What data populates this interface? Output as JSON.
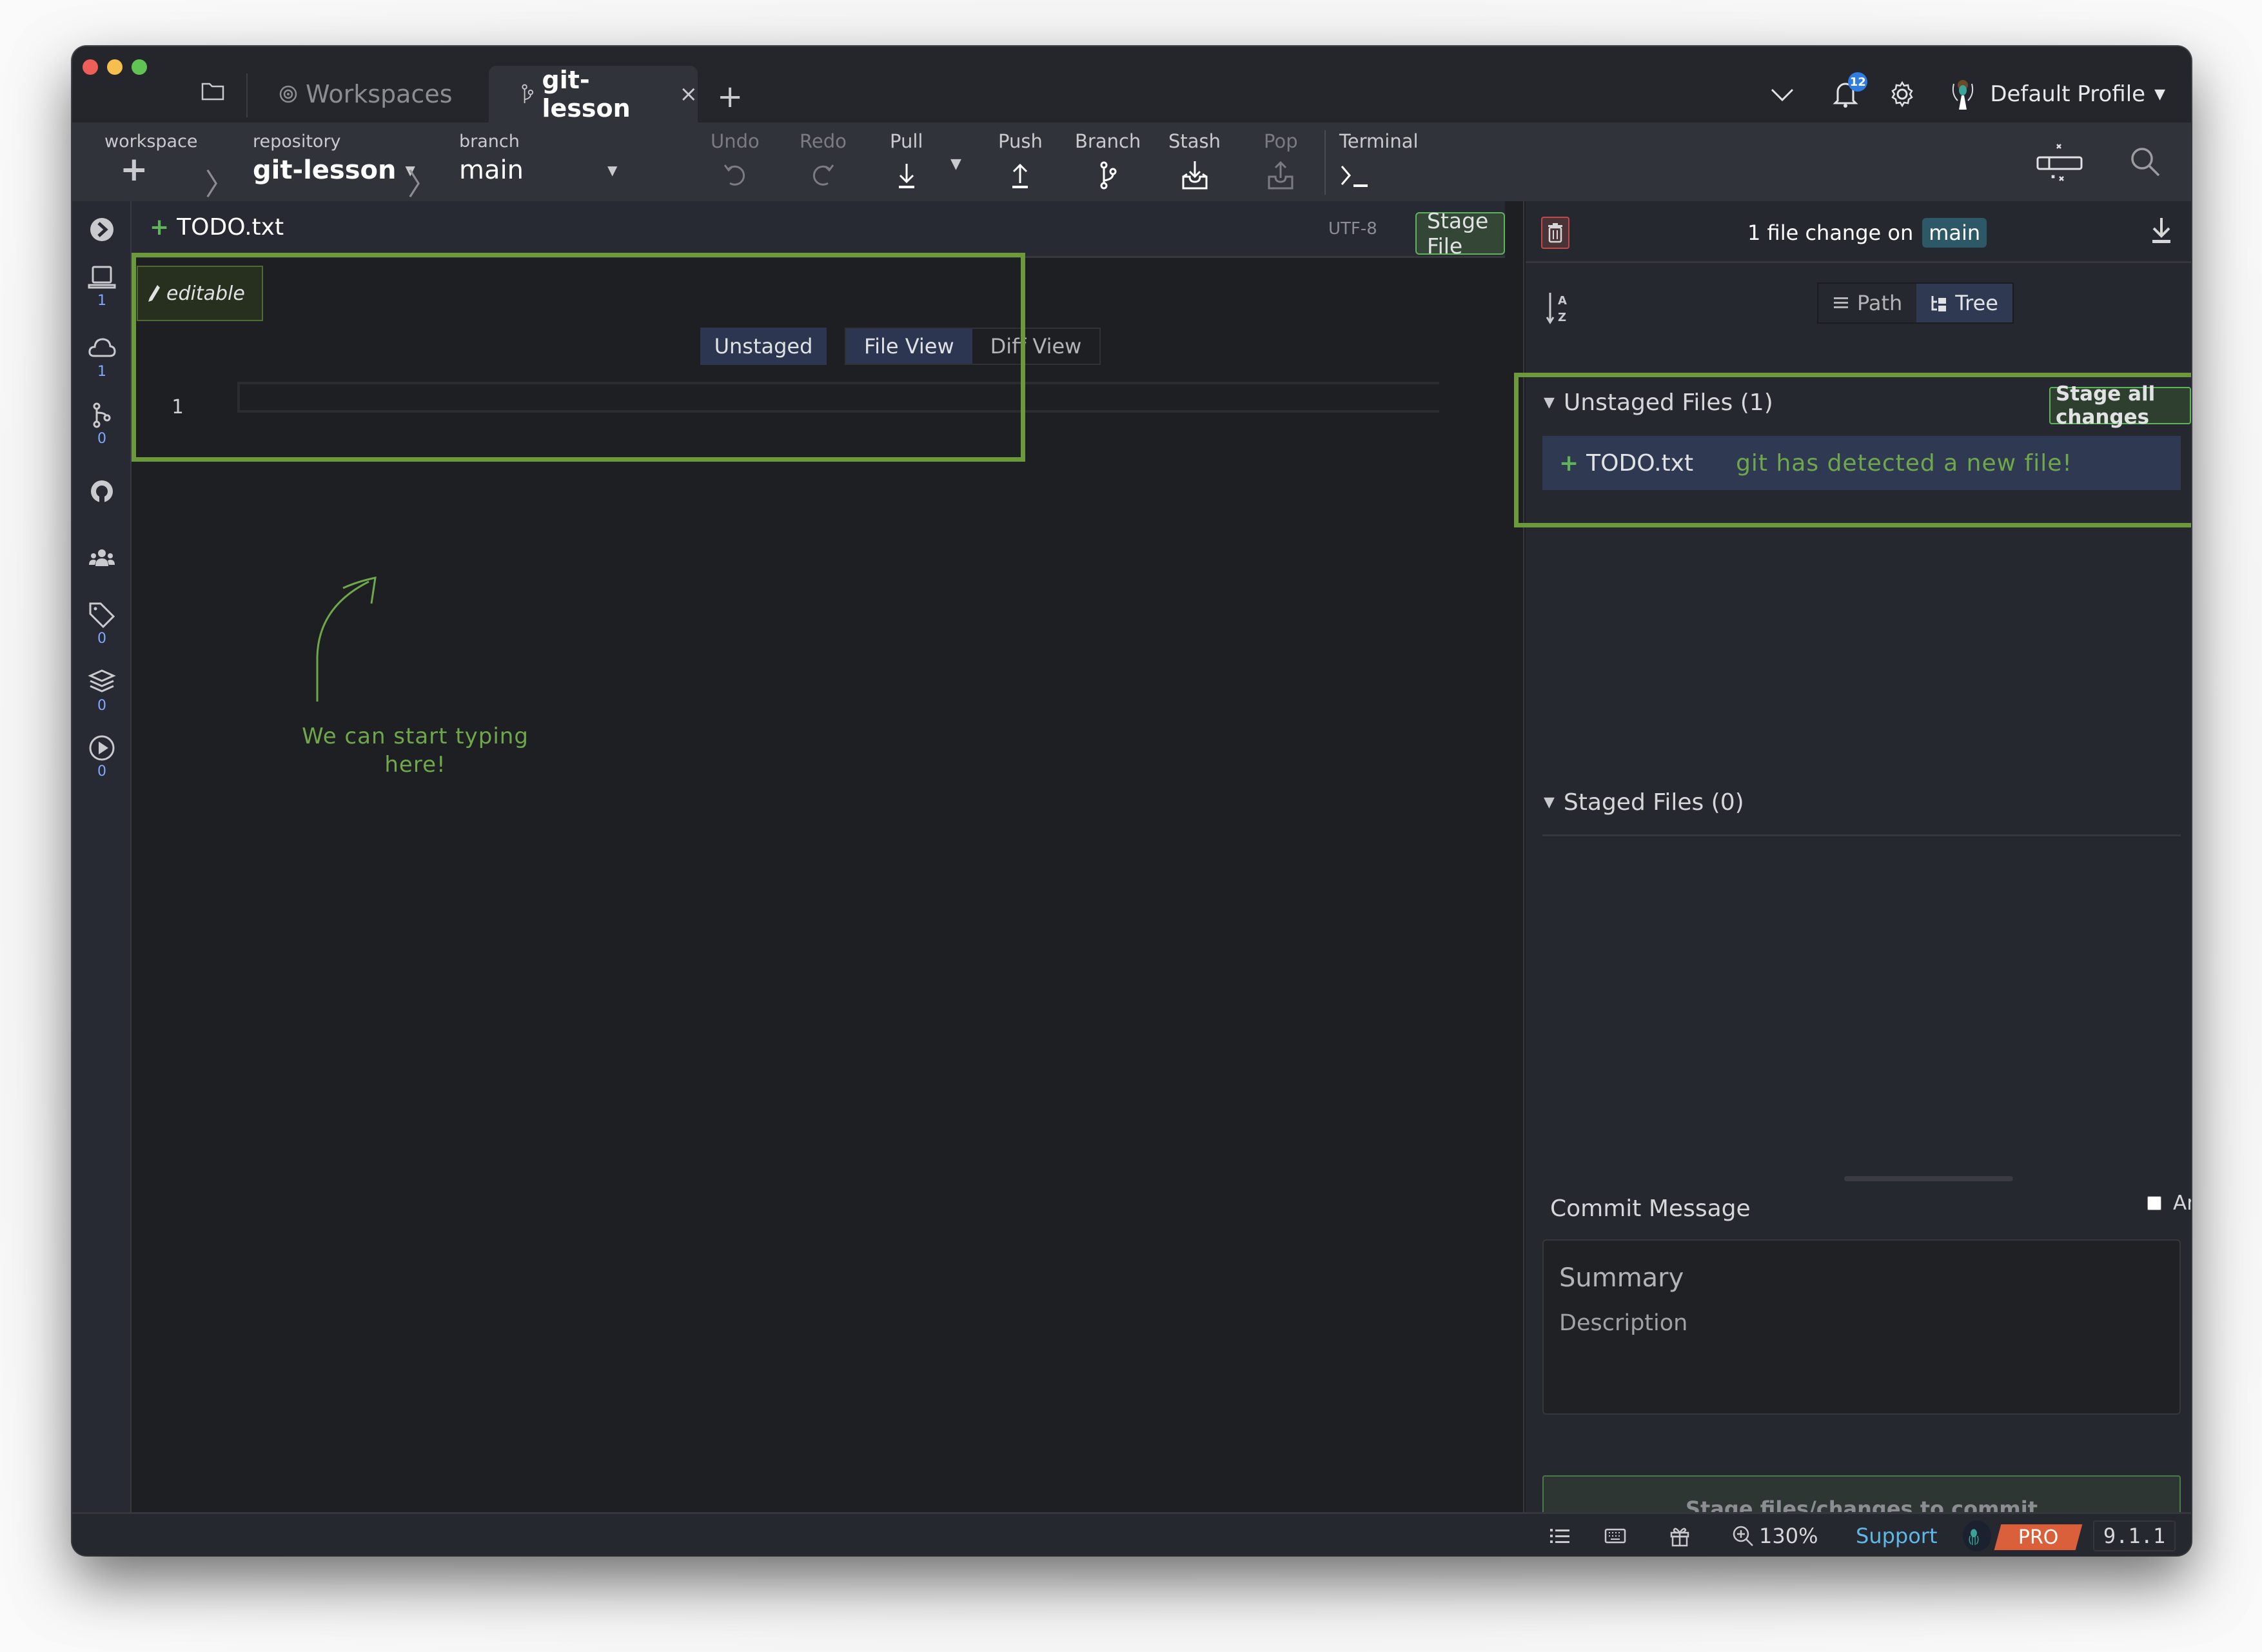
{
  "window": {
    "tabs": [
      {
        "label": "Workspaces",
        "icon": "workspaces-icon",
        "active": false
      },
      {
        "label": "git-lesson",
        "icon": "branch-icon",
        "active": true,
        "close": "×"
      }
    ],
    "new_tab": "+",
    "notifications_count": "12",
    "profile_name": "Default Profile"
  },
  "toolbar": {
    "workspace_label": "workspace",
    "workspace_value": "+",
    "repository_label": "repository",
    "repository_value": "git-lesson",
    "branch_label": "branch",
    "branch_value": "main",
    "actions": {
      "undo": "Undo",
      "redo": "Redo",
      "pull": "Pull",
      "push": "Push",
      "branch": "Branch",
      "stash": "Stash",
      "pop": "Pop",
      "terminal": "Terminal"
    }
  },
  "sidebar": {
    "items": [
      {
        "name": "expand",
        "icon": "expand-icon"
      },
      {
        "name": "local",
        "icon": "laptop-icon",
        "count": "1"
      },
      {
        "name": "remote",
        "icon": "cloud-icon",
        "count": "1"
      },
      {
        "name": "pull-requests",
        "icon": "pull-request-icon",
        "count": "0"
      },
      {
        "name": "github",
        "icon": "github-icon"
      },
      {
        "name": "teams",
        "icon": "team-icon"
      },
      {
        "name": "tags",
        "icon": "tag-icon",
        "count": "0"
      },
      {
        "name": "stashes",
        "icon": "layers-icon",
        "count": "0"
      },
      {
        "name": "actions",
        "icon": "play-icon",
        "count": "0"
      }
    ]
  },
  "editor": {
    "file_status": "+",
    "file_name": "TODO.txt",
    "encoding": "UTF-8",
    "stage_file_label": "Stage File",
    "close": "×",
    "editable_label": "editable",
    "unstaged_label": "Unstaged",
    "file_view_label": "File View",
    "diff_view_label": "Diff View",
    "line_numbers": [
      "1"
    ],
    "annotation": "We can start typing here!"
  },
  "changes_panel": {
    "title_prefix": "1 file change on",
    "branch": "main",
    "path_label": "Path",
    "tree_label": "Tree",
    "unstaged_header": "Unstaged Files (1)",
    "stage_all_label": "Stage all changes",
    "unstaged_files": [
      {
        "status": "+",
        "name": "TODO.txt",
        "annotation": "git has detected a new file!"
      }
    ],
    "staged_header": "Staged Files (0)",
    "commit_message_label": "Commit Message",
    "amend_label": "Amend",
    "amend_checked": false,
    "summary_placeholder": "Summary",
    "description_placeholder": "Description",
    "commit_button_label": "Stage files/changes to commit"
  },
  "statusbar": {
    "zoom": "130%",
    "support": "Support",
    "pro": "PRO",
    "version": "9.1.1"
  },
  "colors": {
    "accent_green": "#5fb35a",
    "annotation_green": "#6ea84a",
    "selection_blue": "#2f3a52",
    "branch_pill": "#2c5868",
    "pro_orange": "#d9603a",
    "support_link": "#5db8e8",
    "badge_blue": "#2f7de1"
  }
}
